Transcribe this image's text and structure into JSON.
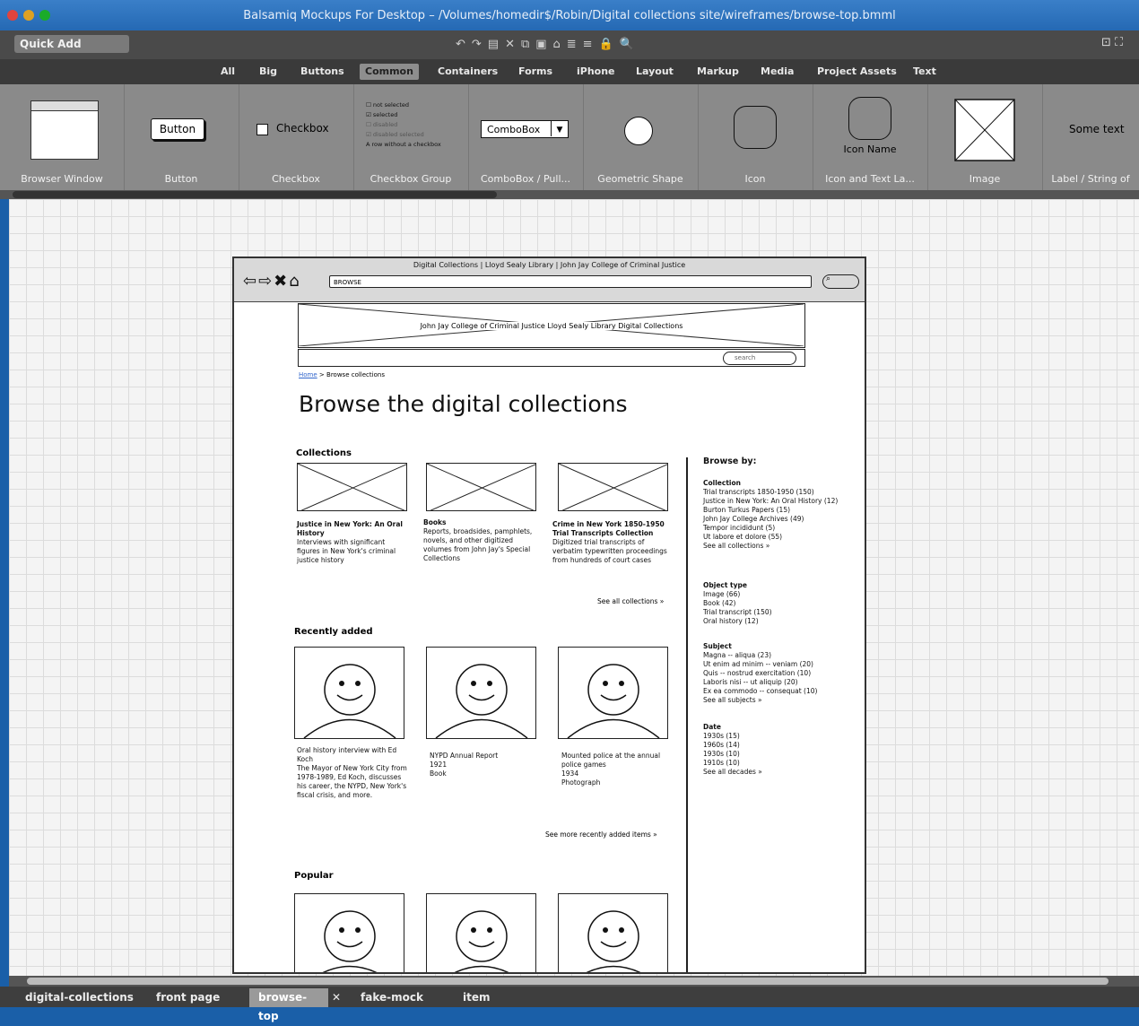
{
  "window": {
    "title": "Balsamiq Mockups For Desktop – /Volumes/homedir$/Robin/Digital collections site/wireframes/browse-top.bmml"
  },
  "toolbar": {
    "quick_add": "Quick Add"
  },
  "categories": [
    "All",
    "Big",
    "Buttons",
    "Common",
    "Containers",
    "Forms",
    "iPhone",
    "Layout",
    "Markup",
    "Media",
    "Project Assets",
    "Text"
  ],
  "selected_category": "Common",
  "gallery": {
    "browser_window": "Browser Window",
    "button": "Button",
    "button_text": "Button",
    "checkbox": "Checkbox",
    "checkbox_text": "Checkbox",
    "checkbox_group": "Checkbox Group",
    "cg_items": [
      "not selected",
      "selected",
      "disabled",
      "disabled selected",
      "A row without a checkbox"
    ],
    "combobox": "ComboBox / Pull...",
    "combobox_text": "ComboBox",
    "geometric": "Geometric Shape",
    "icon": "Icon",
    "icon_text": "Icon and Text La...",
    "icon_name": "Icon Name",
    "image": "Image",
    "label": "Label / String of",
    "label_text": "Some text"
  },
  "mockup": {
    "title": "Digital Collections | Lloyd Sealy Library | John Jay College of Criminal Justice",
    "url": "BROWSE",
    "banner": "John Jay College of Criminal Justice Lloyd Sealy Library Digital Collections",
    "search_placeholder": "search",
    "crumb_home": "Home",
    "crumb_sep": ">",
    "crumb_current": "Browse collections",
    "heading": "Browse the digital collections",
    "collections_head": "Collections",
    "collections": [
      {
        "title": "Justice in New York: An Oral History",
        "desc": "Interviews with significant figures in New York's criminal justice history"
      },
      {
        "title": "Books",
        "desc": "Reports, broadsides, pamphlets, novels, and other digitized volumes from John Jay's Special Collections"
      },
      {
        "title": "Crime in New York 1850-1950 Trial Transcripts Collection",
        "desc": "Digitized trial transcripts of verbatim typewritten proceedings from hundreds of court cases"
      }
    ],
    "see_all_collections": "See all collections »",
    "recent_head": "Recently added",
    "recent": [
      {
        "text": "Oral history interview with Ed Koch\nThe Mayor of New York City from 1978-1989, Ed Koch, discusses his career, the NYPD, New York's fiscal crisis, and more."
      },
      {
        "text": "NYPD Annual Report\n1921\nBook"
      },
      {
        "text": "Mounted police at the annual police games\n1934\nPhotograph"
      }
    ],
    "see_more_recent": "See more recently added items »",
    "popular_head": "Popular",
    "browse_by": "Browse by:",
    "side_groups": [
      {
        "head": "Collection",
        "items": [
          "Trial transcripts 1850-1950 (150)",
          "Justice in New York: An Oral History (12)",
          "Burton Turkus Papers (15)",
          "John Jay College Archives (49)",
          "Tempor incididunt (5)",
          "Ut labore et dolore (55)",
          "See all collections »"
        ]
      },
      {
        "head": "Object type",
        "items": [
          "Image (66)",
          "Book (42)",
          "Trial transcript (150)",
          "Oral history (12)"
        ]
      },
      {
        "head": "Subject",
        "items": [
          "Magna -- aliqua (23)",
          "Ut enim ad minim -- veniam (20)",
          "Quis -- nostrud exercitation (10)",
          "Laboris nisi -- ut aliquip (20)",
          "Ex ea commodo -- consequat (10)",
          "See all subjects »"
        ]
      },
      {
        "head": "Date",
        "items": [
          "1930s (15)",
          "1960s (14)",
          "1930s (10)",
          "1910s (10)",
          "See all decades »"
        ]
      }
    ]
  },
  "tabs": [
    "digital-collections",
    "front page",
    "browse-top",
    "fake-mock",
    "item"
  ],
  "selected_tab": "browse-top"
}
